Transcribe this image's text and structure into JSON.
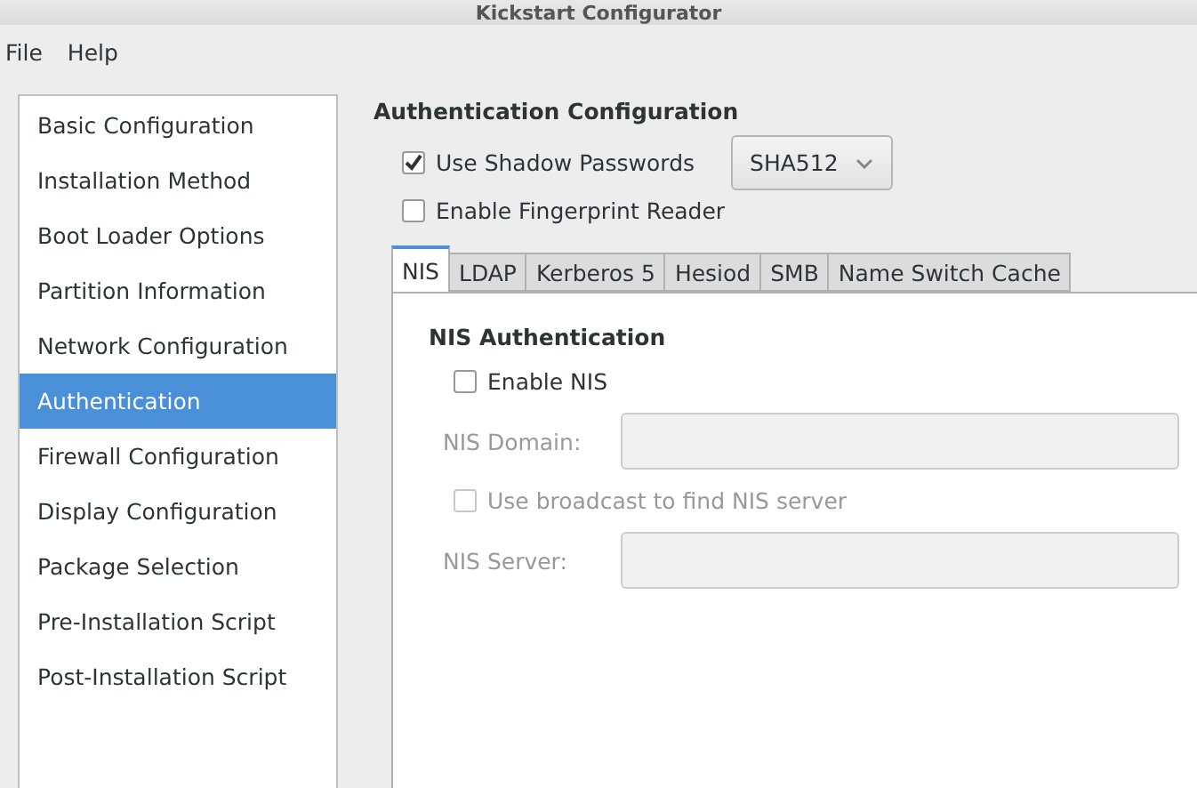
{
  "window": {
    "title": "Kickstart Configurator"
  },
  "menu": [
    "File",
    "Help"
  ],
  "sidebar": {
    "items": [
      {
        "label": "Basic Configuration",
        "selected": false
      },
      {
        "label": "Installation Method",
        "selected": false
      },
      {
        "label": "Boot Loader Options",
        "selected": false
      },
      {
        "label": "Partition Information",
        "selected": false
      },
      {
        "label": "Network Configuration",
        "selected": false
      },
      {
        "label": "Authentication",
        "selected": true
      },
      {
        "label": "Firewall Configuration",
        "selected": false
      },
      {
        "label": "Display Configuration",
        "selected": false
      },
      {
        "label": "Package Selection",
        "selected": false
      },
      {
        "label": "Pre-Installation Script",
        "selected": false
      },
      {
        "label": "Post-Installation Script",
        "selected": false
      }
    ]
  },
  "section": {
    "title": "Authentication Configuration",
    "shadow": {
      "label": "Use Shadow Passwords",
      "checked": true,
      "algorithm": "SHA512"
    },
    "fingerprint": {
      "label": "Enable Fingerprint Reader",
      "checked": false
    }
  },
  "tabs": [
    {
      "label": "NIS",
      "selected": true
    },
    {
      "label": "LDAP",
      "selected": false
    },
    {
      "label": "Kerberos 5",
      "selected": false
    },
    {
      "label": "Hesiod",
      "selected": false
    },
    {
      "label": "SMB",
      "selected": false
    },
    {
      "label": "Name Switch Cache",
      "selected": false
    }
  ],
  "nis": {
    "title": "NIS Authentication",
    "enable": {
      "label": "Enable NIS",
      "checked": false
    },
    "domain": {
      "label": "NIS Domain:",
      "disabled": true
    },
    "broadcast": {
      "label": "Use broadcast to find NIS server",
      "checked": false,
      "disabled": true
    },
    "server": {
      "label": "NIS Server:",
      "disabled": true
    }
  }
}
